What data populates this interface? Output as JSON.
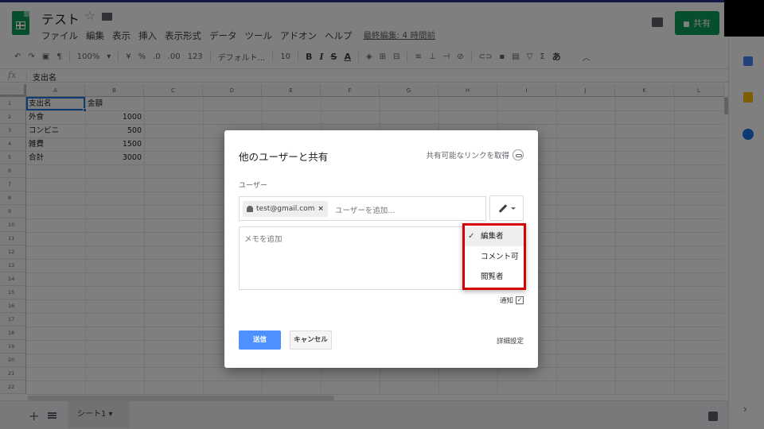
{
  "header": {
    "doc_title": "テスト",
    "menu": [
      "ファイル",
      "編集",
      "表示",
      "挿入",
      "表示形式",
      "データ",
      "ツール",
      "アドオン",
      "ヘルプ"
    ],
    "last_edit": "最終編集: 4 時間前",
    "share_label": "共有"
  },
  "toolbar": {
    "zoom": "100%",
    "currency": "¥",
    "percent": "%",
    "decimal_less": ".0",
    "decimal_more": ".00",
    "format_more": "123",
    "font": "デフォルト...",
    "font_size": "10",
    "bold": "B",
    "italic": "I",
    "strike": "S",
    "text_color": "A",
    "input_tool": "あ"
  },
  "formula_bar": {
    "fx": "fx",
    "value": "支出名"
  },
  "grid": {
    "columns": [
      "A",
      "B",
      "C",
      "D",
      "E",
      "F",
      "G",
      "H",
      "I",
      "J",
      "K",
      "L"
    ],
    "rows": [
      "1",
      "2",
      "3",
      "4",
      "5",
      "6",
      "7",
      "8",
      "9",
      "10",
      "11",
      "12",
      "13",
      "14",
      "15",
      "16",
      "17",
      "18",
      "19",
      "20",
      "21",
      "22"
    ],
    "cells": [
      {
        "name": "支出名",
        "value": "金額"
      },
      {
        "name": "外食",
        "value": "1000"
      },
      {
        "name": "コンビニ",
        "value": "500"
      },
      {
        "name": "雑費",
        "value": "1500"
      },
      {
        "name": "合計",
        "value": "3000"
      }
    ]
  },
  "sheets": {
    "active": "シート1 ▾"
  },
  "dialog": {
    "title": "他のユーザーと共有",
    "get_link": "共有可能なリンクを取得",
    "users_label": "ユーザー",
    "chip_email": "test@gmail.com",
    "chip_close": "×",
    "add_user_placeholder": "ユーザーを追加...",
    "memo_placeholder": "メモを追加",
    "notify_label": "通知",
    "notify_check": "✓",
    "send_label": "送信",
    "cancel_label": "キャンセル",
    "advanced_label": "詳細設定",
    "permissions": [
      {
        "label": "編集者",
        "selected": true,
        "check": "✓"
      },
      {
        "label": "コメント可",
        "selected": false,
        "check": ""
      },
      {
        "label": "閲覧者",
        "selected": false,
        "check": ""
      }
    ]
  },
  "colors": {
    "brand": "#0f9d58",
    "accent": "#4d90fe",
    "highlight": "#d50000"
  }
}
